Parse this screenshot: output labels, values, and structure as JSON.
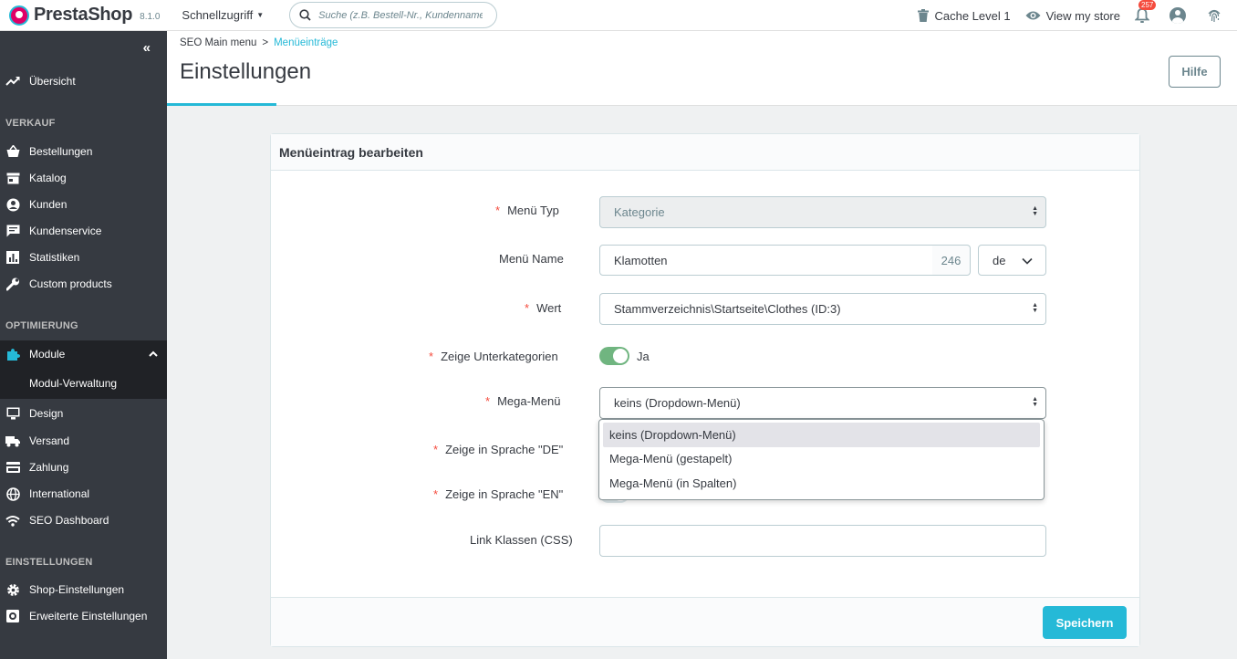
{
  "header": {
    "brand": "PrestaShop",
    "version": "8.1.0",
    "quick_access": "Schnellzugriff",
    "search_placeholder": "Suche (z.B. Bestell-Nr., Kundenname ...",
    "cache": "Cache Level 1",
    "view_store": "View my store",
    "notifications": "257"
  },
  "sidebar": {
    "overview": "Übersicht",
    "sections": {
      "sales": "VERKAUF",
      "optimization": "OPTIMIERUNG",
      "settings": "EINSTELLUNGEN"
    },
    "items": {
      "orders": "Bestellungen",
      "catalog": "Katalog",
      "customers": "Kunden",
      "customer_service": "Kundenservice",
      "stats": "Statistiken",
      "custom_products": "Custom products",
      "modules": "Module",
      "module_manager": "Modul-Verwaltung",
      "design": "Design",
      "shipping": "Versand",
      "payment": "Zahlung",
      "international": "International",
      "seo_dashboard": "SEO Dashboard",
      "shop_settings": "Shop-Einstellungen",
      "advanced_settings": "Erweiterte Einstellungen"
    }
  },
  "page": {
    "breadcrumb_parent": "SEO Main menu",
    "breadcrumb_sep": ">",
    "breadcrumb_current": "Menüeinträge",
    "title": "Einstellungen",
    "help": "Hilfe"
  },
  "form": {
    "panel_title": "Menüeintrag bearbeiten",
    "required_mark": "*",
    "menu_type": {
      "label": "Menü Typ",
      "value": "Kategorie"
    },
    "menu_name": {
      "label": "Menü Name",
      "value": "Klamotten",
      "counter": "246",
      "lang": "de"
    },
    "value": {
      "label": "Wert",
      "value": "Stammverzeichnis\\Startseite\\Clothes (ID:3)"
    },
    "show_subcategories": {
      "label": "Zeige Unterkategorien",
      "state": "Ja"
    },
    "mega_menu": {
      "label": "Mega-Menü",
      "value": "keins (Dropdown-Menü)",
      "options": [
        "keins (Dropdown-Menü)",
        "Mega-Menü (gestapelt)",
        "Mega-Menü (in Spalten)"
      ]
    },
    "show_de": {
      "label": "Zeige in Sprache \"DE\""
    },
    "show_en": {
      "label": "Zeige in Sprache \"EN\""
    },
    "link_classes": {
      "label": "Link Klassen (CSS)",
      "value": ""
    },
    "save": "Speichern"
  },
  "colors": {
    "accent": "#25b9d7",
    "sidebar": "#363a41",
    "required": "#f54c3e",
    "toggle_on": "#70b580",
    "highlight": "#ffff00"
  }
}
